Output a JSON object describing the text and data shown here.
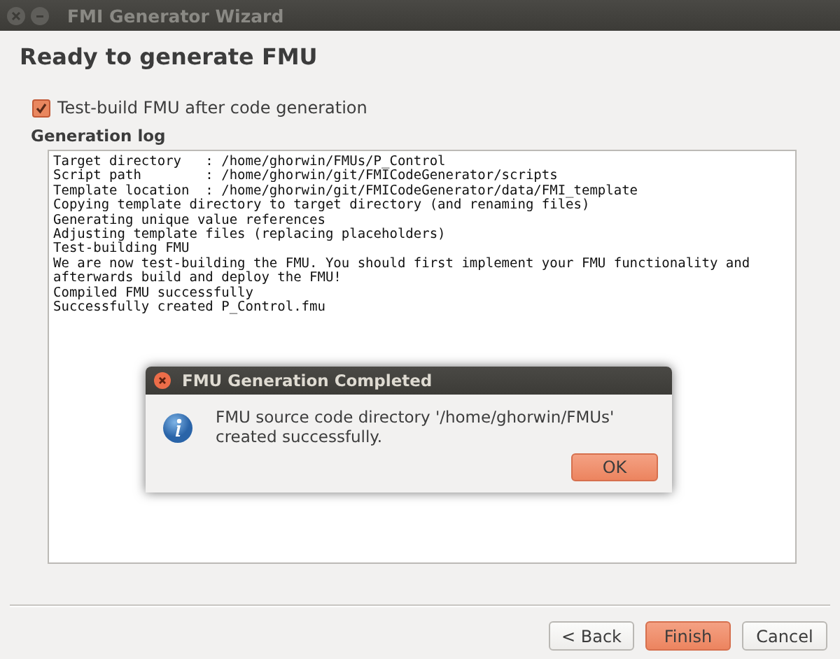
{
  "window": {
    "title": "FMI Generator Wizard"
  },
  "page": {
    "heading": "Ready to generate FMU",
    "test_build": {
      "label": "Test-build FMU after code generation",
      "checked": true
    },
    "log_label": "Generation log",
    "log_lines": [
      "Target directory   : /home/ghorwin/FMUs/P_Control",
      "Script path        : /home/ghorwin/git/FMICodeGenerator/scripts",
      "Template location  : /home/ghorwin/git/FMICodeGenerator/data/FMI_template",
      "Copying template directory to target directory (and renaming files)",
      "Generating unique value references",
      "Adjusting template files (replacing placeholders)",
      "Test-building FMU",
      "We are now test-building the FMU. You should first implement your FMU functionality and",
      "afterwards build and deploy the FMU!",
      "Compiled FMU successfully",
      "Successfully created P_Control.fmu"
    ]
  },
  "dialog": {
    "title": "FMU Generation Completed",
    "message": "FMU source code directory '/home/ghorwin/FMUs' created successfully.",
    "button": "OK"
  },
  "buttons": [
    {
      "label": "< Back",
      "kind": "normal"
    },
    {
      "label": "Finish",
      "kind": "default"
    },
    {
      "label": "Cancel",
      "kind": "normal"
    }
  ]
}
